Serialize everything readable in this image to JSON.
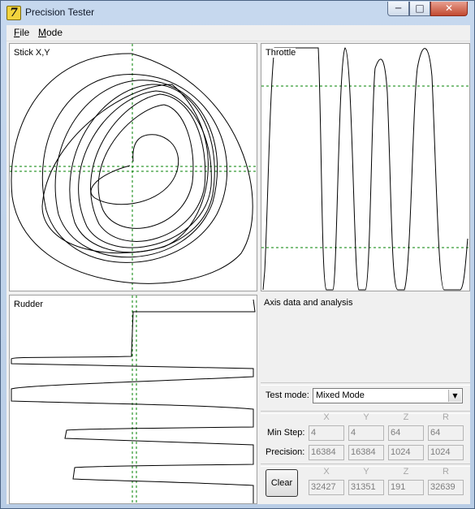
{
  "window": {
    "title": "Precision Tester",
    "app_icon": "yellow-7-icon",
    "accent": "#b9cde6"
  },
  "menu": [
    "File",
    "Mode"
  ],
  "caption_buttons": {
    "minimize": "minimize-icon",
    "maximize": "maximize-icon",
    "close": "close-icon"
  },
  "panels": {
    "stick": "Stick X,Y",
    "throttle": "Throttle",
    "rudder": "Rudder"
  },
  "info": {
    "title": "Axis data and analysis",
    "test_mode_label": "Test mode:",
    "test_mode_value": "Mixed Mode",
    "axis_headers": [
      "X",
      "Y",
      "Z",
      "R"
    ],
    "min_step_label": "Min Step:",
    "min_step": [
      "4",
      "4",
      "64",
      "64"
    ],
    "precision_label": "Precision:",
    "precision": [
      "16384",
      "16384",
      "1024",
      "1024"
    ],
    "current_headers": [
      "X",
      "Y",
      "Z",
      "R"
    ],
    "current": [
      "32427",
      "31351",
      "191",
      "32639"
    ],
    "clear_label": "Clear"
  },
  "colors": {
    "plot_line": "#000000",
    "guide_line": "#008000"
  }
}
